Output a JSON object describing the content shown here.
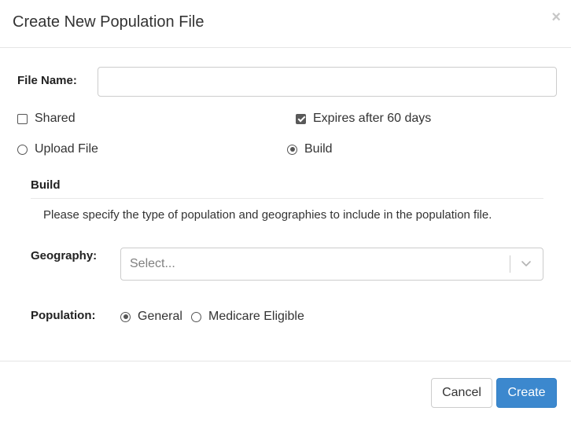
{
  "modal": {
    "title": "Create New Population File",
    "close_glyph": "×"
  },
  "form": {
    "file_name_label": "File Name:",
    "file_name_value": "",
    "file_name_placeholder": "",
    "shared": {
      "label": "Shared",
      "checked": false
    },
    "expires": {
      "label": "Expires after 60 days",
      "checked": true
    },
    "source_options": [
      {
        "label": "Upload File",
        "selected": false
      },
      {
        "label": "Build",
        "selected": true
      }
    ]
  },
  "build_section": {
    "title": "Build",
    "description": "Please specify the type of population and geographies to include in the population file.",
    "geography_label": "Geography:",
    "geography_placeholder": "Select...",
    "population_label": "Population:",
    "population_options": [
      {
        "label": "General",
        "selected": true
      },
      {
        "label": "Medicare Eligible",
        "selected": false
      }
    ]
  },
  "footer": {
    "cancel_label": "Cancel",
    "create_label": "Create"
  },
  "icons": {
    "close": "close-icon",
    "select_chevron": "chevron-down-icon"
  },
  "colors": {
    "primary": "#3c88ce",
    "border": "#cccccc",
    "text": "#333333"
  }
}
